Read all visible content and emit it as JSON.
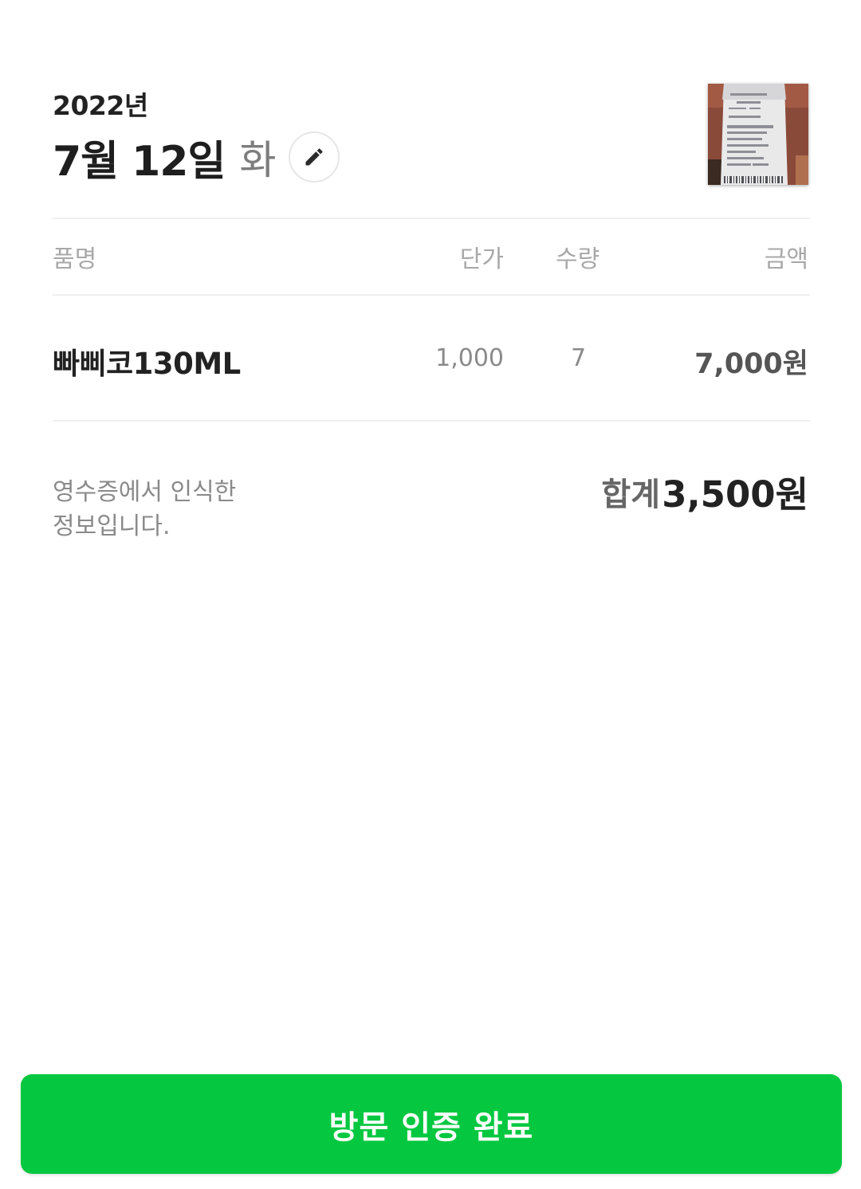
{
  "header": {
    "year": "2022년",
    "date": "7월 12일",
    "weekday": "화",
    "edit_icon": "pencil-icon",
    "receipt_thumbnail": "receipt-photo"
  },
  "table": {
    "columns": [
      "품명",
      "단가",
      "수량",
      "금액"
    ],
    "rows": [
      {
        "name": "빠삐코130ML",
        "unit_price": "1,000",
        "quantity": "7",
        "amount": "7,000원"
      }
    ]
  },
  "summary": {
    "note": "영수증에서 인식한 정보입니다.",
    "total_label": "합계",
    "total_value": "3,500원"
  },
  "footer": {
    "button_label": "방문 인증 완료"
  },
  "colors": {
    "accent": "#06c840",
    "text_primary": "#222222",
    "text_secondary": "#8a8a8a"
  }
}
